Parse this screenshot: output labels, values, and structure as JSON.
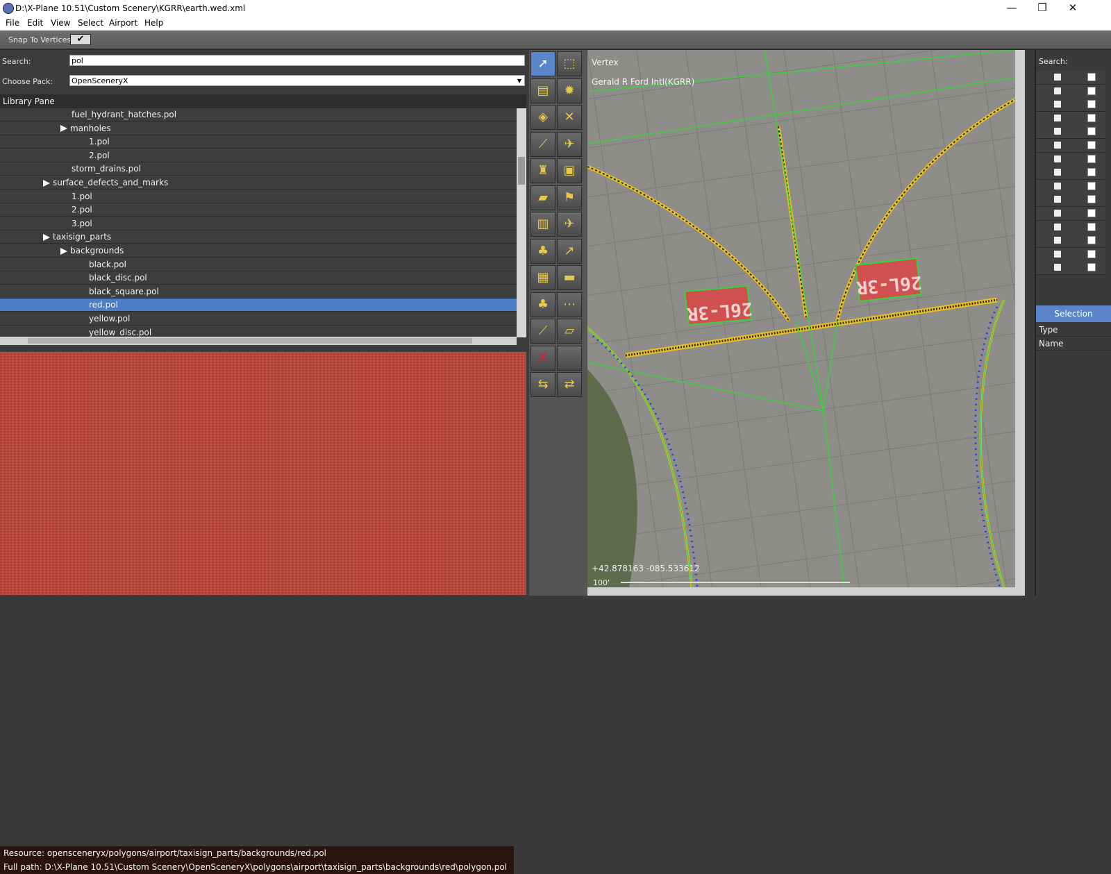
{
  "window": {
    "title": "D:\\X-Plane 10.51\\Custom Scenery\\KGRR\\earth.wed.xml",
    "controls": [
      "—",
      "❐",
      "✕"
    ]
  },
  "menu": [
    "File",
    "Edit",
    "View",
    "Select",
    "Airport",
    "Help"
  ],
  "toolbar": {
    "snap_label": "Snap To Vertices",
    "snap_check": "✔"
  },
  "library": {
    "search_label": "Search:",
    "search_value": "pol",
    "pack_label": "Choose Pack:",
    "pack_value": "OpenSceneryX",
    "pack_arrow": "▼",
    "pane_title": "Library Pane",
    "items": [
      {
        "label": "fuel_hydrant_hatches.pol",
        "indent": 3,
        "folder": false
      },
      {
        "label": "manholes",
        "indent": 3,
        "folder": true
      },
      {
        "label": "1.pol",
        "indent": 4,
        "folder": false
      },
      {
        "label": "2.pol",
        "indent": 4,
        "folder": false
      },
      {
        "label": "storm_drains.pol",
        "indent": 3,
        "folder": false
      },
      {
        "label": "surface_defects_and_marks",
        "indent": 2,
        "folder": true
      },
      {
        "label": "1.pol",
        "indent": 3,
        "folder": false
      },
      {
        "label": "2.pol",
        "indent": 3,
        "folder": false
      },
      {
        "label": "3.pol",
        "indent": 3,
        "folder": false
      },
      {
        "label": "taxisign_parts",
        "indent": 2,
        "folder": true
      },
      {
        "label": "backgrounds",
        "indent": 3,
        "folder": true
      },
      {
        "label": "black.pol",
        "indent": 4,
        "folder": false
      },
      {
        "label": "black_disc.pol",
        "indent": 4,
        "folder": false
      },
      {
        "label": "black_square.pol",
        "indent": 4,
        "folder": false
      },
      {
        "label": "red.pol",
        "indent": 4,
        "folder": false,
        "selected": true
      },
      {
        "label": "yellow.pol",
        "indent": 4,
        "folder": false
      },
      {
        "label": "yellow_disc.pol",
        "indent": 4,
        "folder": false
      }
    ]
  },
  "preview": {
    "resource": "Resource: opensceneryx/polygons/airport/taxisign_parts/backgrounds/red.pol",
    "full_path": "Full path: D:\\X-Plane 10.51\\Custom Scenery\\OpenSceneryX\\polygons\\airport\\taxisign_parts\\backgrounds\\red\\polygon.pol"
  },
  "tools": [
    "select-arrow-icon",
    "marquee-select-icon",
    "runway-icon",
    "light-fixture-icon",
    "helipad-icon",
    "taxiway-icon",
    "taxi-line-icon",
    "ramp-start-icon",
    "tower-viewpoint-icon",
    "taxi-sign-icon",
    "object-icon",
    "windsock-icon",
    "facade-icon",
    "airplane-icon",
    "forest-icon",
    "atc-flow-icon",
    "building-icon",
    "truck-icon",
    "tree-icon",
    "taxiroute-icon",
    "line-icon",
    "polygon-icon",
    "exclusion-icon",
    "blank-icon",
    "truck-parking-icon",
    "truck-destination-icon"
  ],
  "map": {
    "tool_name": "Vertex",
    "airport": "Gerald R Ford Intl(KGRR)",
    "coords": "+42.878163 -085.533612",
    "scale": "100'",
    "sign_left": "26L-3R",
    "sign_right": "26L-3R",
    "colors": {
      "pavement": "#8e8c88",
      "taxiline": "#e8c020",
      "route": "#39d23a",
      "light": "#2040e0",
      "sign_bg": "#d04848"
    }
  },
  "hierarchy": {
    "search_label": "Search:",
    "rows": 15
  },
  "properties": {
    "tab": "Selection",
    "fields": [
      "Type",
      "Name"
    ]
  }
}
